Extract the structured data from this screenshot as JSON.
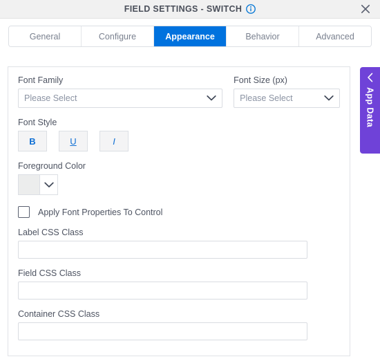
{
  "titlebar": {
    "title": "FIELD SETTINGS - SWITCH",
    "info_icon": "info-circle-icon",
    "close_icon": "close-icon"
  },
  "tabs": [
    {
      "label": "General",
      "active": false
    },
    {
      "label": "Configure",
      "active": false
    },
    {
      "label": "Appearance",
      "active": true
    },
    {
      "label": "Behavior",
      "active": false
    },
    {
      "label": "Advanced",
      "active": false
    }
  ],
  "form": {
    "font_family": {
      "label": "Font Family",
      "value": "Please Select"
    },
    "font_size": {
      "label": "Font Size (px)",
      "value": "Please Select"
    },
    "font_style": {
      "label": "Font Style",
      "bold": "B",
      "underline": "U",
      "italic": "I"
    },
    "foreground_color": {
      "label": "Foreground Color",
      "swatch": "#eceded"
    },
    "apply_font_properties": {
      "label": "Apply Font Properties To Control",
      "checked": false
    },
    "label_css_class": {
      "label": "Label CSS Class",
      "value": "",
      "placeholder": ""
    },
    "field_css_class": {
      "label": "Field CSS Class",
      "value": "",
      "placeholder": ""
    },
    "container_css_class": {
      "label": "Container CSS Class",
      "value": "",
      "placeholder": ""
    }
  },
  "app_data_tab": {
    "label": "App Data",
    "chevron_icon": "chevron-left-icon"
  },
  "colors": {
    "accent_blue": "#0072de",
    "purple": "#6f42d8",
    "link_blue": "#0f6fd4"
  }
}
